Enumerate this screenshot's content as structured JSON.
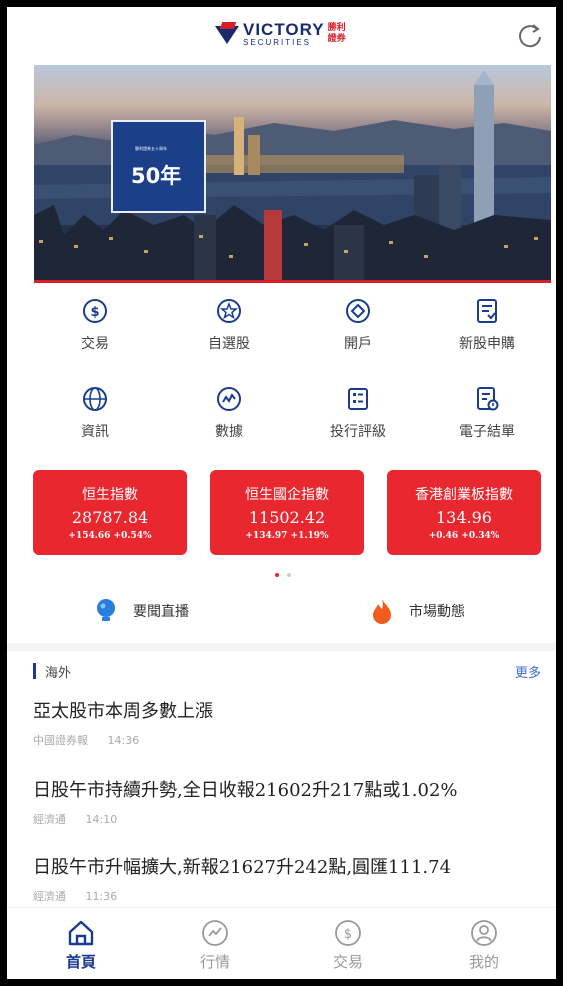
{
  "header": {
    "brand_en": "VICTORY",
    "brand_en_sub": "SECURITIES",
    "brand_cn_1": "勝利",
    "brand_cn_2": "證券",
    "refresh_icon": "refresh-icon"
  },
  "banner": {
    "badge_small": "勝利證券五十周年",
    "badge_big": "50年"
  },
  "grid": [
    {
      "label": "交易",
      "icon": "dollar-circle-icon"
    },
    {
      "label": "自選股",
      "icon": "star-circle-icon"
    },
    {
      "label": "開戶",
      "icon": "diamond-circle-icon"
    },
    {
      "label": "新股申購",
      "icon": "ipo-form-icon"
    },
    {
      "label": "資訊",
      "icon": "globe-icon"
    },
    {
      "label": "數據",
      "icon": "chart-circle-icon"
    },
    {
      "label": "投行評級",
      "icon": "rating-grid-icon"
    },
    {
      "label": "電子結單",
      "icon": "statement-icon"
    }
  ],
  "indices": [
    {
      "name": "恒生指數",
      "value": "28787.84",
      "change": "+154.66 +0.54%"
    },
    {
      "name": "恒生國企指數",
      "value": "11502.42",
      "change": "+134.97 +1.19%"
    },
    {
      "name": "香港創業板指數",
      "value": "134.96",
      "change": "+0.46 +0.34%"
    }
  ],
  "carousel": {
    "active_index": 0,
    "count": 2
  },
  "quick_links": [
    {
      "label": "要聞直播",
      "icon": "lightbulb-icon"
    },
    {
      "label": "市場動態",
      "icon": "flame-icon"
    }
  ],
  "news": {
    "section": "海外",
    "more": "更多",
    "items": [
      {
        "title": "亞太股市本周多數上漲",
        "source": "中國證券報",
        "time": "14:36"
      },
      {
        "title": "日股午市持續升勢,全日收報21602升217點或1.02%",
        "source": "經濟通",
        "time": "14:10"
      },
      {
        "title": "日股午市升幅擴大,新報21627升242點,圓匯111.74",
        "source": "經濟通",
        "time": "11:36"
      }
    ]
  },
  "tabs": [
    {
      "label": "首頁",
      "icon": "home-icon",
      "active": true
    },
    {
      "label": "行情",
      "icon": "market-icon",
      "active": false
    },
    {
      "label": "交易",
      "icon": "trade-icon",
      "active": false
    },
    {
      "label": "我的",
      "icon": "profile-icon",
      "active": false
    }
  ],
  "colors": {
    "accent": "#1a3c8f",
    "card_red": "#e8272f",
    "brand_red": "#d81e2a"
  }
}
